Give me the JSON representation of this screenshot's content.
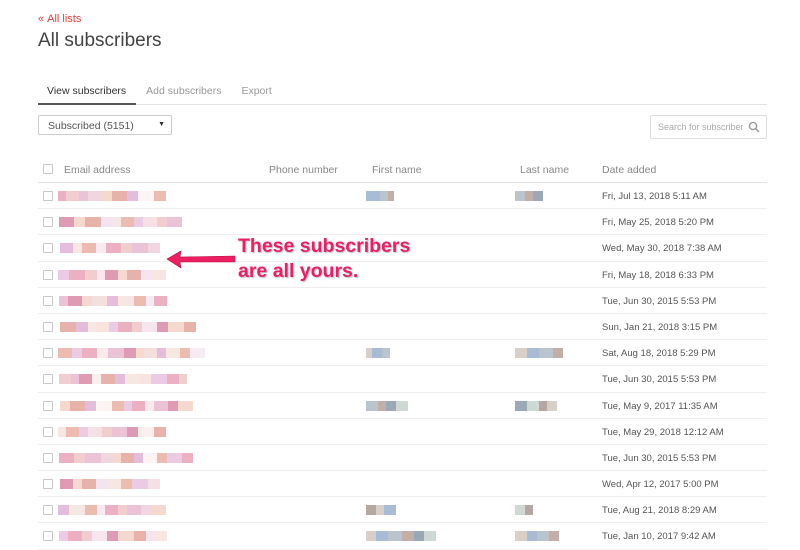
{
  "nav": {
    "back_label": "All lists"
  },
  "page": {
    "title": "All subscribers"
  },
  "tabs": [
    {
      "label": "View subscribers",
      "active": true
    },
    {
      "label": "Add subscribers",
      "active": false
    },
    {
      "label": "Export",
      "active": false
    }
  ],
  "filter": {
    "selected": "Subscribed (5151)"
  },
  "search": {
    "placeholder": "Search for subscriber"
  },
  "table": {
    "columns": [
      "Email address",
      "Phone number",
      "First name",
      "Last name",
      "Date added"
    ],
    "rows": [
      {
        "date_added": "Fri, Jul 13, 2018 5:11 AM"
      },
      {
        "date_added": "Fri, May 25, 2018 5:20 PM"
      },
      {
        "date_added": "Wed, May 30, 2018 7:38 AM"
      },
      {
        "date_added": "Fri, May 18, 2018 6:33 PM"
      },
      {
        "date_added": "Tue, Jun 30, 2015 5:53 PM"
      },
      {
        "date_added": "Sun, Jan 21, 2018 3:15 PM"
      },
      {
        "date_added": "Sat, Aug 18, 2018 5:29 PM"
      },
      {
        "date_added": "Tue, Jun 30, 2015 5:53 PM"
      },
      {
        "date_added": "Tue, May 9, 2017 11:35 AM"
      },
      {
        "date_added": "Tue, May 29, 2018 12:12 AM"
      },
      {
        "date_added": "Tue, Jun 30, 2015 5:53 PM"
      },
      {
        "date_added": "Wed, Apr 12, 2017 5:00 PM"
      },
      {
        "date_added": "Tue, Aug 21, 2018 8:29 AM"
      },
      {
        "date_added": "Tue, Jan 10, 2017 9:42 AM"
      }
    ]
  },
  "annotation": {
    "line1": "These subscribers",
    "line2": "are all yours."
  },
  "colors": {
    "accent": "#e0413c",
    "annotation": "#ee1e63"
  },
  "icons": {
    "back": "double-chevron-left-icon",
    "search": "search-icon",
    "select": "caret-down-icon",
    "annotation_arrow": "arrow-left-icon"
  }
}
